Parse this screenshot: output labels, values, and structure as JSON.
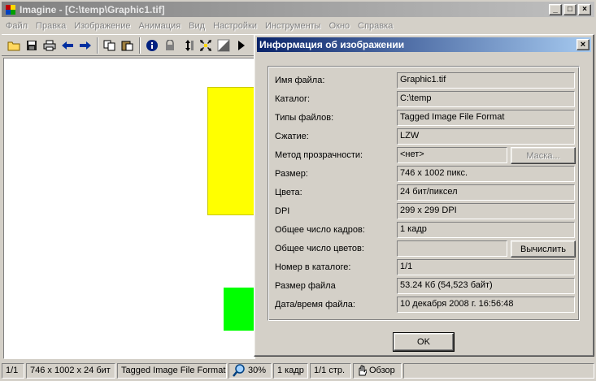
{
  "window": {
    "title": "Imagine - [C:\\temp\\Graphic1.tif]",
    "buttons": {
      "minimize": "_",
      "maximize": "□",
      "close": "×"
    }
  },
  "menu": [
    "Файл",
    "Правка",
    "Изображение",
    "Анимация",
    "Вид",
    "Настройки",
    "Инструменты",
    "Окно",
    "Справка"
  ],
  "toolbar": [
    "open-folder-icon",
    "save-icon",
    "print-icon",
    "back-arrow-icon",
    "forward-arrow-icon",
    "copy-icon",
    "paste-icon",
    "info-icon",
    "lock-icon",
    "fit-height-icon",
    "fit-all-icon",
    "transparency-icon",
    "play-icon"
  ],
  "status": {
    "frame": "1/1",
    "dims": "746 x 1002 x 24 бит",
    "format": "Tagged Image File Format",
    "zoom": "30%",
    "frames": "1 кадр",
    "pages": "1/1 стр.",
    "view_mode": "Обзор"
  },
  "dialog": {
    "title": "Информация об изображении",
    "close_label": "×",
    "fields": [
      {
        "label": "Имя файла:",
        "value": "Graphic1.tif"
      },
      {
        "label": "Каталог:",
        "value": "C:\\temp"
      },
      {
        "label": "Типы файлов:",
        "value": "Tagged Image File Format"
      },
      {
        "label": "Сжатие:",
        "value": "LZW"
      },
      {
        "label": "Метод прозрачности:",
        "value": "<нет>",
        "button": "Маска..."
      },
      {
        "label": "Размер:",
        "value": "746 x 1002 пикс."
      },
      {
        "label": "Цвета:",
        "value": "24 бит/пиксел"
      },
      {
        "label": "DPI",
        "value": "299 x 299 DPI"
      },
      {
        "label": "Общее число кадров:",
        "value": "1 кадр"
      },
      {
        "label": "Общее число цветов:",
        "value": "",
        "button": "Вычислить"
      },
      {
        "label": "Номер в каталоге:",
        "value": "1/1"
      },
      {
        "label": "Размер файла",
        "value": "53.24 Кб (54,523 байт)"
      },
      {
        "label": "Дата/время файла:",
        "value": "10 декабря 2008 г. 16:56:48"
      }
    ],
    "ok_label": "OK"
  },
  "colors": {
    "yellow_shape": "#ffff00",
    "green_shape": "#00ff00",
    "dialog_title": "#0a246a"
  }
}
